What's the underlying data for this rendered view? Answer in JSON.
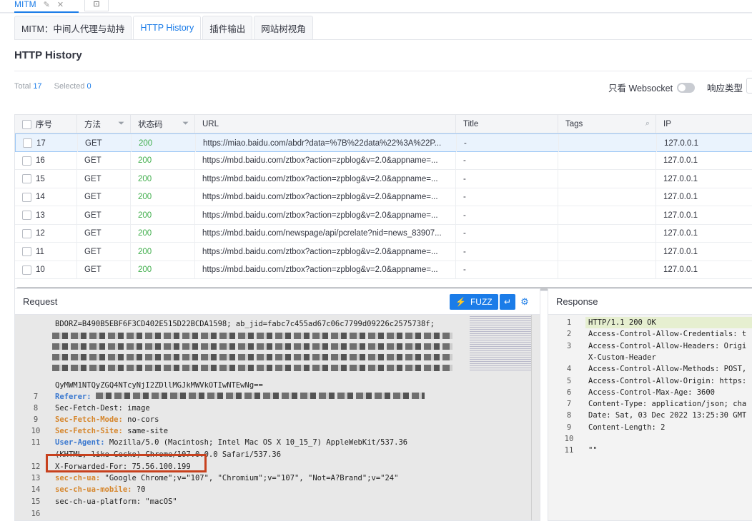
{
  "app_tab": {
    "label": "MITM"
  },
  "sub_tabs": [
    {
      "label": "MITM：中间人代理与劫持"
    },
    {
      "label": "HTTP History"
    },
    {
      "label": "插件输出"
    },
    {
      "label": "网站树视角"
    }
  ],
  "section_title": "HTTP History",
  "stats": {
    "total_label": "Total",
    "total": "17",
    "selected_label": "Selected",
    "selected": "0"
  },
  "filters": {
    "websocket_label": "只看 Websocket",
    "response_type_label": "响应类型"
  },
  "table": {
    "columns": [
      "序号",
      "方法",
      "状态码",
      "URL",
      "Title",
      "Tags",
      "IP"
    ],
    "rows": [
      {
        "id": "17",
        "method": "GET",
        "status": "200",
        "url": "https://miao.baidu.com/abdr?data=%7B%22data%22%3A%22P...",
        "title": "-",
        "tags": "",
        "ip": "127.0.0.1"
      },
      {
        "id": "16",
        "method": "GET",
        "status": "200",
        "url": "https://mbd.baidu.com/ztbox?action=zpblog&v=2.0&appname=...",
        "title": "-",
        "tags": "",
        "ip": "127.0.0.1"
      },
      {
        "id": "15",
        "method": "GET",
        "status": "200",
        "url": "https://mbd.baidu.com/ztbox?action=zpblog&v=2.0&appname=...",
        "title": "-",
        "tags": "",
        "ip": "127.0.0.1"
      },
      {
        "id": "14",
        "method": "GET",
        "status": "200",
        "url": "https://mbd.baidu.com/ztbox?action=zpblog&v=2.0&appname=...",
        "title": "-",
        "tags": "",
        "ip": "127.0.0.1"
      },
      {
        "id": "13",
        "method": "GET",
        "status": "200",
        "url": "https://mbd.baidu.com/ztbox?action=zpblog&v=2.0&appname=...",
        "title": "-",
        "tags": "",
        "ip": "127.0.0.1"
      },
      {
        "id": "12",
        "method": "GET",
        "status": "200",
        "url": "https://mbd.baidu.com/newspage/api/pcrelate?nid=news_83907...",
        "title": "-",
        "tags": "",
        "ip": "127.0.0.1"
      },
      {
        "id": "11",
        "method": "GET",
        "status": "200",
        "url": "https://mbd.baidu.com/ztbox?action=zpblog&v=2.0&appname=...",
        "title": "-",
        "tags": "",
        "ip": "127.0.0.1"
      },
      {
        "id": "10",
        "method": "GET",
        "status": "200",
        "url": "https://mbd.baidu.com/ztbox?action=zpblog&v=2.0&appname=...",
        "title": "-",
        "tags": "",
        "ip": "127.0.0.1"
      }
    ]
  },
  "request": {
    "title": "Request",
    "fuzz_label": "FUZZ",
    "lines": [
      {
        "ln": "",
        "text": "BDORZ=B490B5EBF6F3CD402E515D22BCDA1598; ab_jid=fabc7c455ad67c06c7799d09226c2575738f;"
      },
      {
        "ln": "",
        "text": "QyMWM1NTQyZGQ4NTcyNjI2ZDllMGJkMWVkOTIwNTEwNg=="
      },
      {
        "ln": "7",
        "key": "Referer:",
        "text": ""
      },
      {
        "ln": "8",
        "text": "Sec-Fetch-Dest: image"
      },
      {
        "ln": "9",
        "key": "Sec-Fetch-Mode:",
        "text": " no-cors"
      },
      {
        "ln": "10",
        "key": "Sec-Fetch-Site:",
        "text": " same-site"
      },
      {
        "ln": "11",
        "key": "User-Agent:",
        "text": " Mozilla/5.0 (Macintosh; Intel Mac OS X 10_15_7) AppleWebKit/537.36"
      },
      {
        "ln": "",
        "text": "(KHTML, like Gecko) Chrome/107.0.0.0 Safari/537.36"
      },
      {
        "ln": "12",
        "text": "X-Forwarded-For: 75.56.100.199"
      },
      {
        "ln": "13",
        "key": "sec-ch-ua:",
        "text": " \"Google Chrome\";v=\"107\", \"Chromium\";v=\"107\", \"Not=A?Brand\";v=\"24\""
      },
      {
        "ln": "14",
        "key": "sec-ch-ua-mobile:",
        "text": " ?0"
      },
      {
        "ln": "15",
        "text": "sec-ch-ua-platform: \"macOS\""
      },
      {
        "ln": "16",
        "text": ""
      }
    ]
  },
  "response": {
    "title": "Response",
    "lines": [
      {
        "ln": "1",
        "text": "HTTP/1.1 200 OK"
      },
      {
        "ln": "2",
        "text": "Access-Control-Allow-Credentials: t"
      },
      {
        "ln": "3",
        "text": "Access-Control-Allow-Headers: Origi"
      },
      {
        "ln": "",
        "text": "X-Custom-Header"
      },
      {
        "ln": "4",
        "text": "Access-Control-Allow-Methods: POST,"
      },
      {
        "ln": "5",
        "text": "Access-Control-Allow-Origin: https:"
      },
      {
        "ln": "6",
        "text": "Access-Control-Max-Age: 3600"
      },
      {
        "ln": "7",
        "text": "Content-Type: application/json; cha"
      },
      {
        "ln": "8",
        "text": "Date: Sat, 03 Dec 2022 13:25:30 GMT"
      },
      {
        "ln": "9",
        "text": "Content-Length: 2"
      },
      {
        "ln": "10",
        "text": ""
      },
      {
        "ln": "11",
        "text": "\"\""
      }
    ]
  },
  "colors": {
    "accent": "#1b7ce8",
    "status_ok": "#3fae4b",
    "highlight": "#c7411e"
  }
}
